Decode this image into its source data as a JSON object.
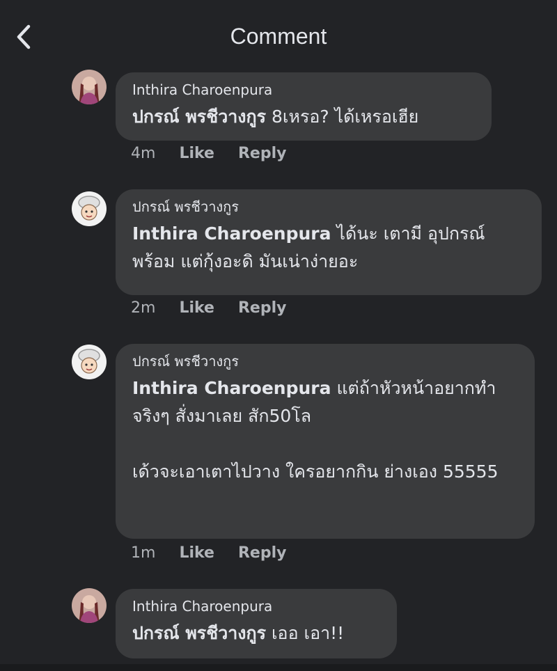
{
  "header": {
    "title": "Comment"
  },
  "comments": [
    {
      "author": "Inthira Charoenpura",
      "mention": "ปกรณ์ พรชีวางกูร",
      "text": " 8เหรอ? ได้เหรอเฮีย",
      "time": "4m",
      "like": "Like",
      "reply": "Reply"
    },
    {
      "author": "ปกรณ์ พรชีวางกูร",
      "mention": "Inthira Charoenpura",
      "text": " ได้นะ เตามี อุปกรณ์พร้อม แต่กุ้งอะดิ มันเน่าง่ายอะ",
      "time": "2m",
      "like": "Like",
      "reply": "Reply"
    },
    {
      "author": "ปกรณ์ พรชีวางกูร",
      "mention": "Inthira Charoenpura",
      "text": " แต่ถ้าหัวหน้าอยากทำจริงๆ สั่งมาเลย สัก50โล\n\nเด้วจะเอาเตาไปวาง ใครอยากกิน ย่างเอง 55555",
      "time": "1m",
      "like": "Like",
      "reply": "Reply"
    },
    {
      "author": "Inthira Charoenpura",
      "mention": "ปกรณ์ พรชีวางกูร",
      "text": " เออ เอา!!",
      "time": "",
      "like": "",
      "reply": ""
    }
  ]
}
